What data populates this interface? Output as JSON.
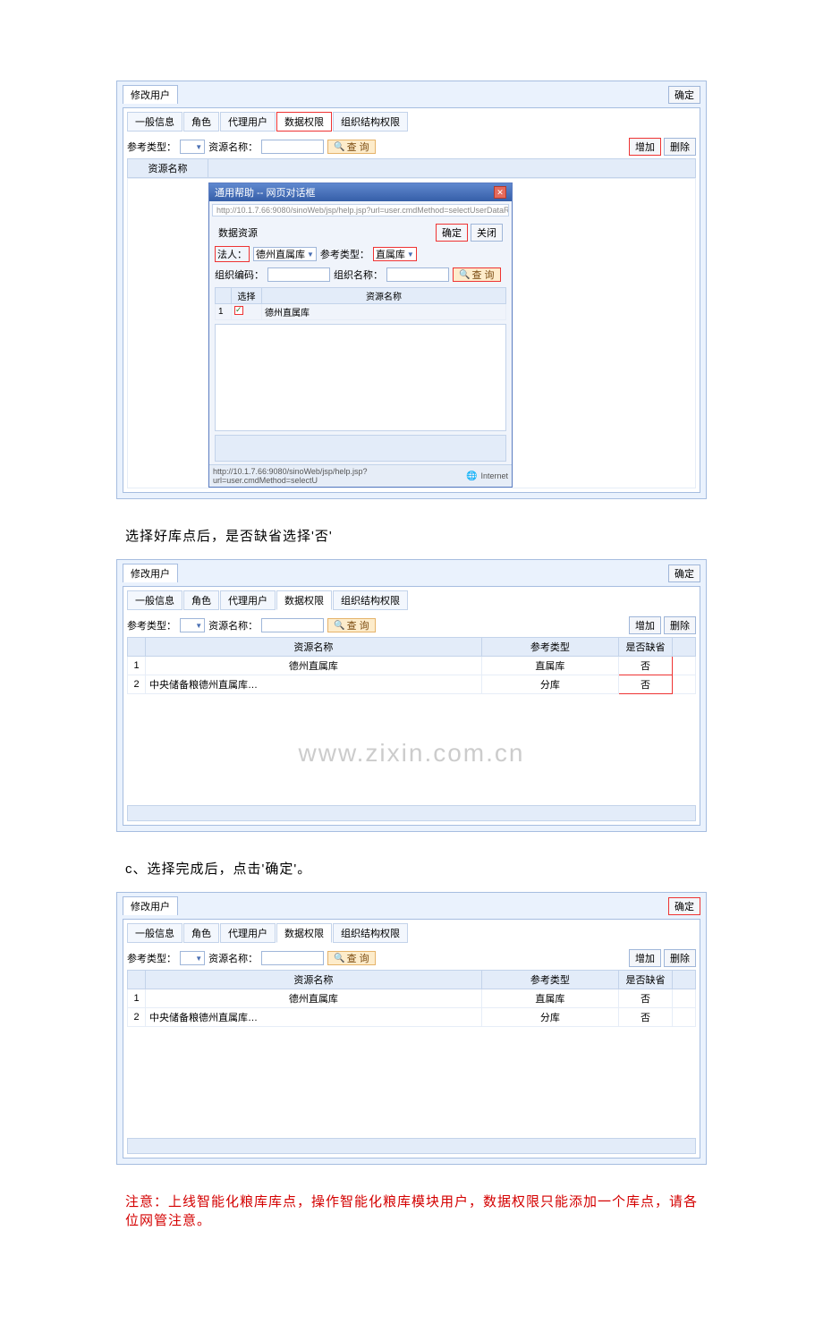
{
  "s1": {
    "windowTab": "修改用户",
    "confirm": "确定",
    "tabs": {
      "general": "一般信息",
      "role": "角色",
      "proxy": "代理用户",
      "data": "数据权限",
      "org": "组织结构权限"
    },
    "ref_type_label": "参考类型：",
    "res_name_label": "资源名称：",
    "search": "查 询",
    "add": "增加",
    "del": "删除",
    "col_res": "资源名称",
    "dialog": {
      "title": "通用帮助 -- 网页对话框",
      "url": "http://10.1.7.66:9080/sinoWeb/jsp/help.jsp?url=user.cmdMethod=selectUserDataResMtree%18%CAD%",
      "dataRes": "数据资源",
      "confirm": "确定",
      "close": "关闭",
      "legal_label": "法人：",
      "legal_value": "德州直属库",
      "ref_type_label": "参考类型：",
      "ref_type_value": "直属库",
      "org_code_label": "组织编码：",
      "org_name_label": "组织名称：",
      "search": "查 询",
      "col_sel": "选择",
      "col_res": "资源名称",
      "row1": "德州直属库",
      "footer": "http://10.1.7.66:9080/sinoWeb/jsp/help.jsp?url=user.cmdMethod=selectU",
      "footer_net": "Internet"
    }
  },
  "cap1": "选择好库点后，是否缺省选择'否'",
  "s2": {
    "windowTab": "修改用户",
    "confirm": "确定",
    "tabs": {
      "general": "一般信息",
      "role": "角色",
      "proxy": "代理用户",
      "data": "数据权限",
      "org": "组织结构权限"
    },
    "ref_type_label": "参考类型：",
    "res_name_label": "资源名称：",
    "search": "查 询",
    "add": "增加",
    "del": "删除",
    "col_res": "资源名称",
    "col_type": "参考类型",
    "col_def": "是否缺省",
    "rows": [
      {
        "n": "1",
        "res": "德州直属库",
        "type": "直属库",
        "def": "否"
      },
      {
        "n": "2",
        "res": "中央储备粮德州直属库…",
        "type": "分库",
        "def": "否"
      }
    ],
    "watermark": "www.zixin.com.cn"
  },
  "cap2": "c、选择完成后，点击'确定'。",
  "s3": {
    "windowTab": "修改用户",
    "confirm": "确定",
    "tabs": {
      "general": "一般信息",
      "role": "角色",
      "proxy": "代理用户",
      "data": "数据权限",
      "org": "组织结构权限"
    },
    "ref_type_label": "参考类型：",
    "res_name_label": "资源名称：",
    "search": "查 询",
    "add": "增加",
    "del": "删除",
    "col_res": "资源名称",
    "col_type": "参考类型",
    "col_def": "是否缺省",
    "rows": [
      {
        "n": "1",
        "res": "德州直属库",
        "type": "直属库",
        "def": "否"
      },
      {
        "n": "2",
        "res": "中央储备粮德州直属库…",
        "type": "分库",
        "def": "否"
      }
    ]
  },
  "note": "注意：上线智能化粮库库点，操作智能化粮库模块用户，数据权限只能添加一个库点，请各位网管注意。"
}
